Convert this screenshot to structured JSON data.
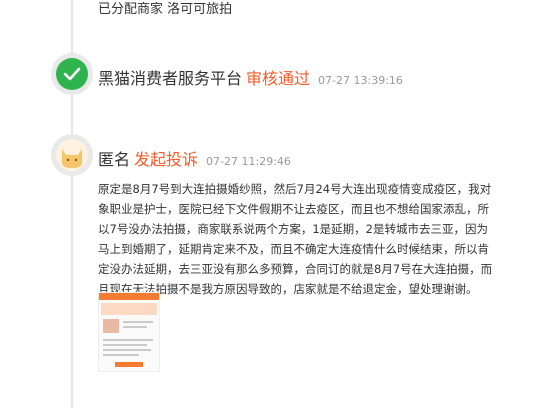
{
  "events": [
    {
      "text": "已分配商家 洛可可旅拍"
    },
    {
      "title": "黑猫消费者服务平台",
      "status": "审核通过",
      "time": "07-27 13:39:16"
    },
    {
      "title": "匿名",
      "status": "发起投诉",
      "time": "07-27 11:29:46",
      "description": "原定是8月7号到大连拍摄婚纱照，然后7月24号大连出现疫情变成疫区，我对象职业是护士，医院已经下文件假期不让去疫区，而且也不想给国家添乱，所以7号没办法拍摄，商家联系说两个方案，1是延期，2是转城市去三亚，因为马上到婚期了，延期肯定来不及，而且不确定大连疫情什么时候结束，所以肯定没办法延期，去三亚没有那么多预算，合同订的就是8月7号在大连拍摄，而且现在无法拍摄不是我方原因导致的，店家就是不给退定金，望处理谢谢。"
    }
  ],
  "colors": {
    "accent": "#f55d2a",
    "check": "#2fb34e",
    "line": "#e6e6e6"
  },
  "icons": {
    "approved": "check-icon",
    "anonymous": "cat-avatar-icon"
  }
}
